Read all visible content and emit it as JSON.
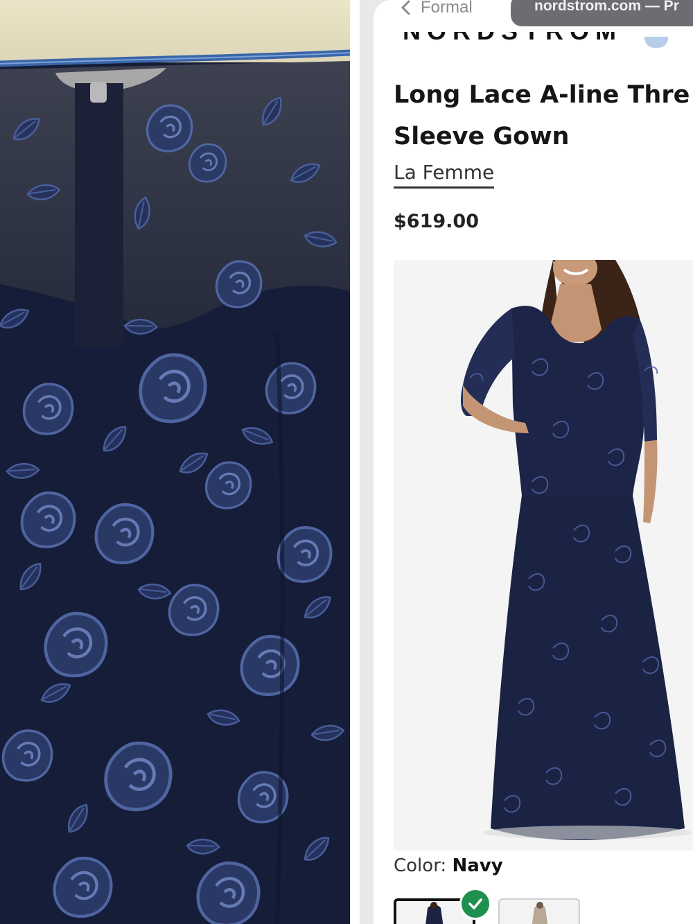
{
  "browser": {
    "back_label": "Formal",
    "url_text": "nordstrom.com — Pr"
  },
  "header": {
    "logo_text": "NORDSTROM"
  },
  "product": {
    "title": "Long Lace A-line Thre\nSleeve Gown",
    "brand": "La Femme",
    "price": "$619.00",
    "color_label": "Color:",
    "color_value": "Navy"
  },
  "swatches": [
    {
      "name": "Navy",
      "selected": true,
      "color": "#1c2340"
    },
    {
      "name": "Other",
      "selected": false,
      "color": "#b9a894"
    }
  ],
  "icons": {
    "back": "chevron-left-icon",
    "selected": "check-icon"
  },
  "colors": {
    "lace": "#1b2340",
    "embroidery": "#3f5591",
    "check_green": "#1f8f4e"
  }
}
